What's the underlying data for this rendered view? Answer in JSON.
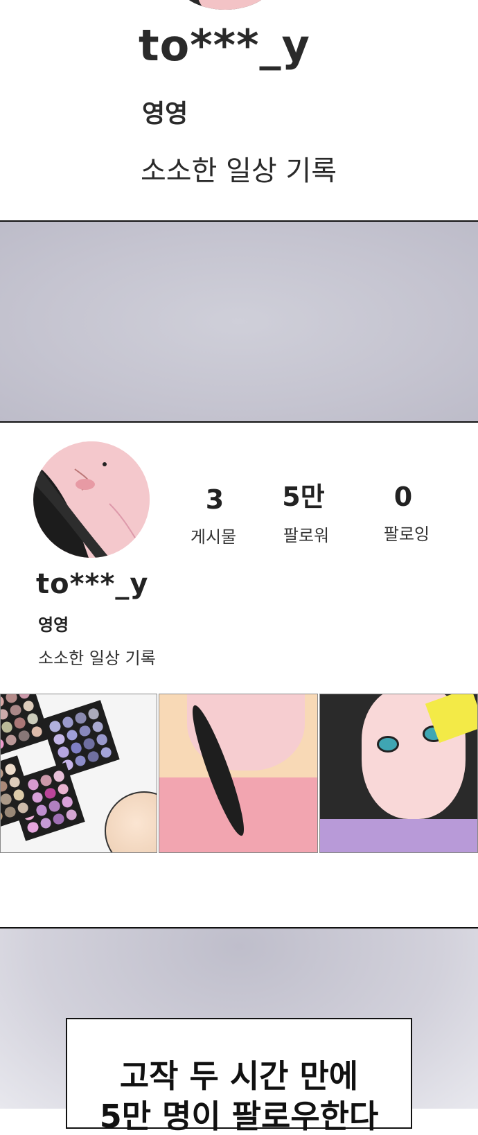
{
  "top_panel": {
    "username": "to***_y",
    "display_name": "영영",
    "bio": "소소한 일상 기록"
  },
  "profile": {
    "stats": [
      {
        "value": "3",
        "label": "게시물"
      },
      {
        "value": "5만",
        "label": "팔로워"
      },
      {
        "value": "0",
        "label": "팔로잉"
      }
    ],
    "username": "to***_y",
    "display_name": "영영",
    "bio": "소소한 일상 기록"
  },
  "speech": {
    "line1": "고작 두 시간 만에",
    "line2": "5만 명이 팔로우한다"
  }
}
